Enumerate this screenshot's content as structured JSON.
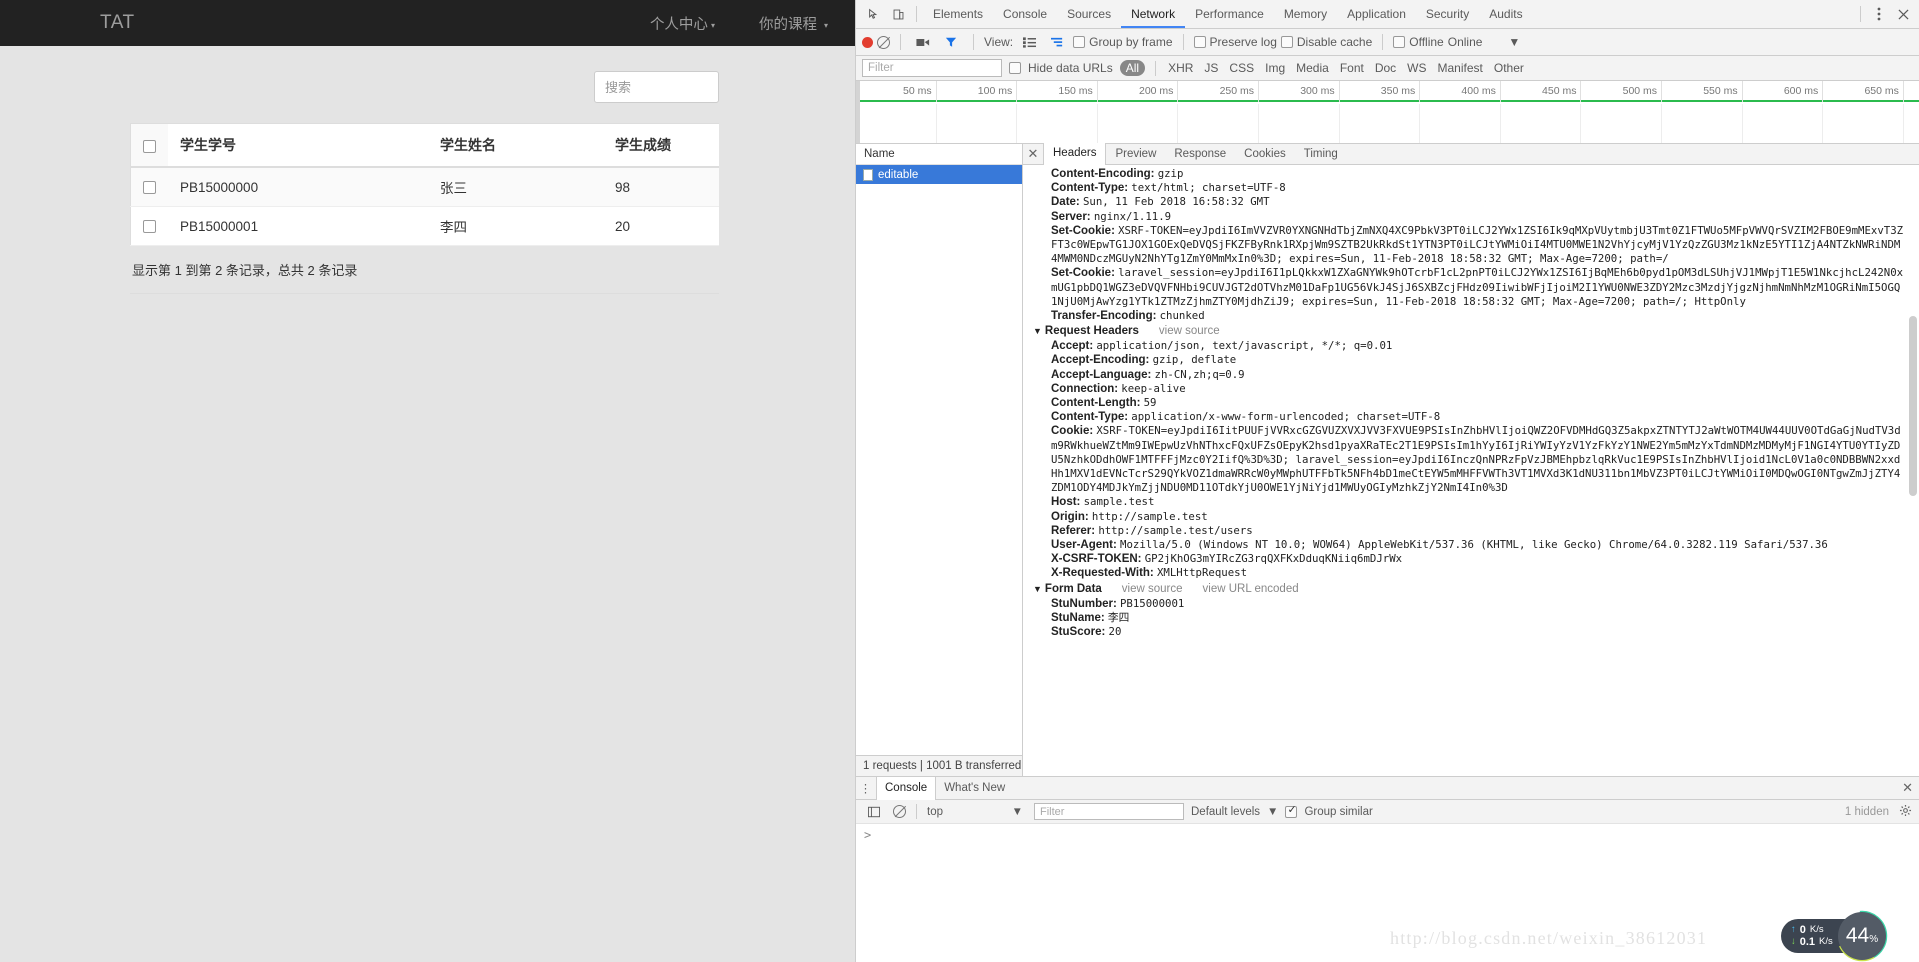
{
  "webpage": {
    "brand": "TAT",
    "nav": [
      {
        "label": "个人中心",
        "caret": "▾"
      },
      {
        "label": "你的课程",
        "caret": "▾"
      }
    ],
    "search": {
      "placeholder": "搜索",
      "value": ""
    },
    "table": {
      "columns": [
        "学生学号",
        "学生姓名",
        "学生成绩"
      ],
      "rows": [
        {
          "number": "PB15000000",
          "name": "张三",
          "score": "98"
        },
        {
          "number": "PB15000001",
          "name": "李四",
          "score": "20"
        }
      ]
    },
    "footer": "显示第 1 到第 2 条记录，总共 2 条记录"
  },
  "devtools": {
    "tabs": [
      "Elements",
      "Console",
      "Sources",
      "Network",
      "Performance",
      "Memory",
      "Application",
      "Security",
      "Audits"
    ],
    "active_tab": "Network",
    "toolbar": {
      "view_label": "View:",
      "group_by_frame": "Group by frame",
      "preserve_log": "Preserve log",
      "disable_cache": "Disable cache",
      "offline": "Offline",
      "online": "Online",
      "throttle_caret": "▼"
    },
    "filterbar": {
      "filter_placeholder": "Filter",
      "filter_value": "",
      "hide_data_urls": "Hide data URLs",
      "types": [
        "All",
        "XHR",
        "JS",
        "CSS",
        "Img",
        "Media",
        "Font",
        "Doc",
        "WS",
        "Manifest",
        "Other"
      ],
      "selected_type": "All"
    },
    "timeline": {
      "ticks": [
        "50 ms",
        "100 ms",
        "150 ms",
        "200 ms",
        "250 ms",
        "300 ms",
        "350 ms",
        "400 ms",
        "450 ms",
        "500 ms",
        "550 ms",
        "600 ms",
        "650 ms"
      ]
    },
    "requests": {
      "header": "Name",
      "items": [
        {
          "name": "editable",
          "selected": true
        }
      ],
      "status": "1 requests | 1001 B transferred"
    },
    "detail": {
      "tabs": [
        "Headers",
        "Preview",
        "Response",
        "Cookies",
        "Timing"
      ],
      "active_tab": "Headers",
      "response_headers": [
        {
          "name": "Content-Encoding:",
          "value": "gzip"
        },
        {
          "name": "Content-Type:",
          "value": "text/html; charset=UTF-8"
        },
        {
          "name": "Date:",
          "value": "Sun, 11 Feb 2018 16:58:32 GMT"
        },
        {
          "name": "Server:",
          "value": "nginx/1.11.9"
        },
        {
          "name": "Set-Cookie:",
          "value": "XSRF-TOKEN=eyJpdiI6ImVVZVR0YXNGNHdTbjZmNXQ4XC9PbkV3PT0iLCJ2YWx1ZSI6Ik9qMXpVUytmbjU3Tmt0Z1FTWUo5MFpVWVQrSVZIM2FBOE9mMExvT3ZFT3c0WEpwTG1JOX1GOExQeDVQSjFKZFByRnk1RXpjWm9SZTB2UkRkdSt1YTN3PT0iLCJtYWMiOiI4MTU0MWE1N2VhYjcyMjV1YzQzZGU3Mz1kNzE5YTI1ZjA4NTZkNWRiNDM4MWM0NDczMGUyN2NhYTg1ZmY0MmMxIn0%3D; expires=Sun, 11-Feb-2018 18:58:32 GMT; Max-Age=7200; path=/"
        },
        {
          "name": "Set-Cookie:",
          "value": "laravel_session=eyJpdiI6I1pLQkkxW1ZXaGNYWk9hOTcrbF1cL2pnPT0iLCJ2YWx1ZSI6IjBqMEh6b0pyd1pOM3dLSUhjVJ1MWpjT1E5W1NkcjhcL242N0xmUG1pbDQ1WGZ3eDVQVFNHbi9CUVJGT2dOTVhzM01DaFp1UG56VkJ4SjJ6SXBZcjFHdz09IiwibWFjIjoiM2I1YWU0NWE3ZDY2Mzc3MzdjYjgzNjhmNmNhMzM1OGRiNmI5OGQ1NjU0MjAwYzg1YTk1ZTMzZjhmZTY0MjdhZiJ9; expires=Sun, 11-Feb-2018 18:58:32 GMT; Max-Age=7200; path=/; HttpOnly"
        },
        {
          "name": "Transfer-Encoding:",
          "value": "chunked"
        }
      ],
      "request_headers_title": "Request Headers",
      "view_source": "view source",
      "request_headers": [
        {
          "name": "Accept:",
          "value": "application/json, text/javascript, */*; q=0.01"
        },
        {
          "name": "Accept-Encoding:",
          "value": "gzip, deflate"
        },
        {
          "name": "Accept-Language:",
          "value": "zh-CN,zh;q=0.9"
        },
        {
          "name": "Connection:",
          "value": "keep-alive"
        },
        {
          "name": "Content-Length:",
          "value": "59"
        },
        {
          "name": "Content-Type:",
          "value": "application/x-www-form-urlencoded; charset=UTF-8"
        },
        {
          "name": "Cookie:",
          "value": "XSRF-TOKEN=eyJpdiI6IitPUUFjVVRxcGZGVUZXVXJVV3FXVUE9PSIsInZhbHVlIjoiQWZ2OFVDMHdGQ3Z5akpxZTNTYTJ2aWtWOTM4UW44UUV0OTdGaGjNudTV3dm9RWkhueWZtMm9IWEpwUzVhNThxcFQxUFZsOEpyK2hsd1pyaXRaTEc2T1E9PSIsIm1hYyI6IjRiYWIyYzV1YzFkYzY1NWE2Ym5mMzYxTdmNDMzMDMyMjF1NGI4YTU0YTIyZDU5NzhkODdhOWF1MTFFFjMzc0Y2IifQ%3D%3D; laravel_session=eyJpdiI6InczQnNPRzFpVzJBMEhpbzlqRkVuc1E9PSIsInZhbHVlIjoid1NcL0V1a0c0NDBBWN2xxdHh1MXV1dEVNcTcrS29QYkVOZ1dmaWRRcW0yMWphUTFFbTk5NFh4bD1meCtEYW5mMHFFVWTh3VT1MVXd3K1dNU311bn1MbVZ3PT0iLCJtYWMiOiI0MDQwOGI0NTgwZmJjZTY4ZDM1ODY4MDJkYmZjjNDU0MD11OTdkYjU0OWE1YjNiYjd1MWUyOGIyMzhkZjY2NmI4In0%3D"
        },
        {
          "name": "Host:",
          "value": "sample.test"
        },
        {
          "name": "Origin:",
          "value": "http://sample.test"
        },
        {
          "name": "Referer:",
          "value": "http://sample.test/users"
        },
        {
          "name": "User-Agent:",
          "value": "Mozilla/5.0 (Windows NT 10.0; WOW64) AppleWebKit/537.36 (KHTML, like Gecko) Chrome/64.0.3282.119 Safari/537.36"
        },
        {
          "name": "X-CSRF-TOKEN:",
          "value": "GP2jKhOG3mYIRcZG3rqQXFKxDduqKNiiq6mDJrWx"
        },
        {
          "name": "X-Requested-With:",
          "value": "XMLHttpRequest"
        }
      ],
      "form_data_title": "Form Data",
      "form_view_source": "view source",
      "form_view_url_encoded": "view URL encoded",
      "form_data": [
        {
          "name": "StuNumber:",
          "value": "PB15000001"
        },
        {
          "name": "StuName:",
          "value": "李四"
        },
        {
          "name": "StuScore:",
          "value": "20"
        }
      ]
    },
    "drawer": {
      "tabs": [
        "Console",
        "What's New"
      ],
      "active_tab": "Console",
      "context": "top",
      "context_caret": "▼",
      "filter_placeholder": "Filter",
      "filter_value": "",
      "levels": "Default levels",
      "levels_caret": "▼",
      "group_similar": "Group similar",
      "hidden": "1 hidden",
      "prompt": ">"
    }
  },
  "overlay": {
    "watermark": "http://blog.csdn.net/weixin_38612031",
    "net_up": "0",
    "net_up_unit": "K/s",
    "net_down": "0.1",
    "net_down_unit": "K/s",
    "cpu_value": "44",
    "cpu_unit": "%"
  }
}
